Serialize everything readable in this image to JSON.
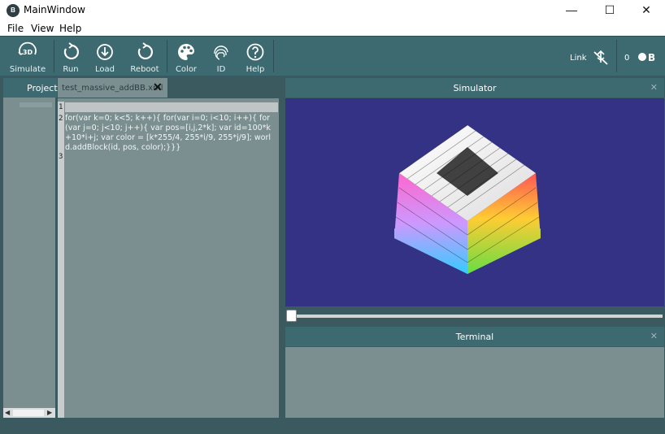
{
  "window": {
    "title": "MainWindow",
    "app_icon_text": "B",
    "min_symbol": "—",
    "max_symbol": "☐",
    "close_symbol": "✕"
  },
  "menu": [
    "File",
    "View",
    "Help"
  ],
  "toolbar": {
    "simulate": "Simulate",
    "run": "Run",
    "load": "Load",
    "reboot": "Reboot",
    "color": "Color",
    "id": "ID",
    "help": "Help",
    "link_label": "Link",
    "count": "0",
    "simulate_badge": "3D"
  },
  "left_panel": {
    "tab": "Projects"
  },
  "editor": {
    "tab_label": "test_massive_addBB.xml",
    "tab_close": "✕",
    "line_numbers": [
      "1",
      "2",
      "3"
    ],
    "code_line2": "for(var k=0; k<5; k++){ for(var i=0; i<10; i++){ for(var j=0; j<10; j++){ var pos=[i,j,2*k]; var id=100*k+10*i+j; var color = [k*255/4, 255*i/9, 255*j/9]; world.addBlock(id, pos, color);}}}"
  },
  "simulator": {
    "title": "Simulator",
    "close": "✕",
    "slider_value": 0
  },
  "terminal": {
    "title": "Terminal",
    "close": "✕"
  },
  "colors": {
    "toolbar": "#3c6a70",
    "panel": "#7c8f90",
    "sim_bg": "#343285"
  }
}
